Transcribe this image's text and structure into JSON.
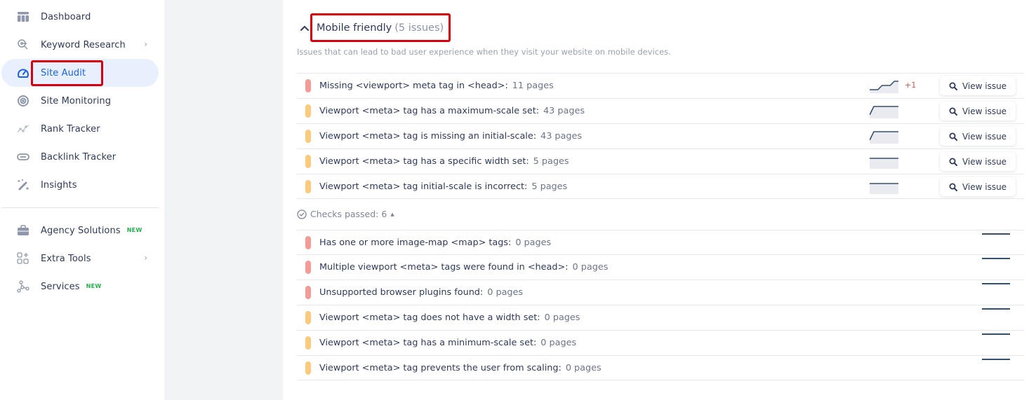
{
  "sidebar": {
    "items": [
      {
        "label": "Dashboard",
        "icon": "dashboard-icon"
      },
      {
        "label": "Keyword Research",
        "icon": "keyword-research-icon",
        "has_submenu": true
      },
      {
        "label": "Site Audit",
        "icon": "gauge-icon",
        "active": true
      },
      {
        "label": "Site Monitoring",
        "icon": "monitoring-icon"
      },
      {
        "label": "Rank Tracker",
        "icon": "rank-tracker-icon"
      },
      {
        "label": "Backlink Tracker",
        "icon": "link-icon"
      },
      {
        "label": "Insights",
        "icon": "magic-wand-icon"
      }
    ],
    "secondary_items": [
      {
        "label": "Agency Solutions",
        "icon": "briefcase-icon",
        "badge": "NEW"
      },
      {
        "label": "Extra Tools",
        "icon": "extra-tools-icon",
        "has_submenu": true
      },
      {
        "label": "Services",
        "icon": "services-icon",
        "badge": "NEW"
      }
    ]
  },
  "section": {
    "title": "Mobile friendly",
    "count_label": "(5 issues)",
    "description": "Issues that can lead to bad user experience when they visit your website on mobile devices.",
    "view_button_label": "View issue",
    "issues": [
      {
        "severity": "error",
        "text": "Missing <viewport> meta tag in <head>:",
        "count": "11 pages",
        "trend": [
          9,
          9,
          9,
          10,
          10,
          10,
          11,
          11
        ],
        "delta": "+1"
      },
      {
        "severity": "warning",
        "text": "Viewport <meta> tag has a maximum-scale set:",
        "count": "43 pages",
        "trend": [
          42,
          43,
          43,
          43,
          43,
          43,
          43,
          43
        ],
        "delta": ""
      },
      {
        "severity": "warning",
        "text": "Viewport <meta> tag is missing an initial-scale:",
        "count": "43 pages",
        "trend": [
          42,
          43,
          43,
          43,
          43,
          43,
          43,
          43
        ],
        "delta": ""
      },
      {
        "severity": "warning",
        "text": "Viewport <meta> tag has a specific width set:",
        "count": "5 pages",
        "trend": [
          5,
          5,
          5,
          5,
          5,
          5,
          5,
          5
        ],
        "delta": ""
      },
      {
        "severity": "warning",
        "text": "Viewport <meta> tag initial-scale is incorrect:",
        "count": "5 pages",
        "trend": [
          5,
          5,
          5,
          5,
          5,
          5,
          5,
          5
        ],
        "delta": ""
      }
    ],
    "checks_passed_label": "Checks passed: 6",
    "passed_checks": [
      {
        "severity": "error",
        "text": "Has one or more image-map <map> tags:",
        "count": "0 pages"
      },
      {
        "severity": "error",
        "text": "Multiple viewport <meta> tags were found in <head>:",
        "count": "0 pages"
      },
      {
        "severity": "error",
        "text": "Unsupported browser plugins found:",
        "count": "0 pages"
      },
      {
        "severity": "warning",
        "text": "Viewport <meta> tag does not have a width set:",
        "count": "0 pages"
      },
      {
        "severity": "warning",
        "text": "Viewport <meta> tag has a minimum-scale set:",
        "count": "0 pages"
      },
      {
        "severity": "warning",
        "text": "Viewport <meta> tag prevents the user from scaling:",
        "count": "0 pages"
      }
    ]
  },
  "colors": {
    "accent": "#1d63e0",
    "error": "#f59a97",
    "warning": "#fdc97a",
    "highlight": "#d9000e",
    "badge_new": "#1cb34a"
  }
}
